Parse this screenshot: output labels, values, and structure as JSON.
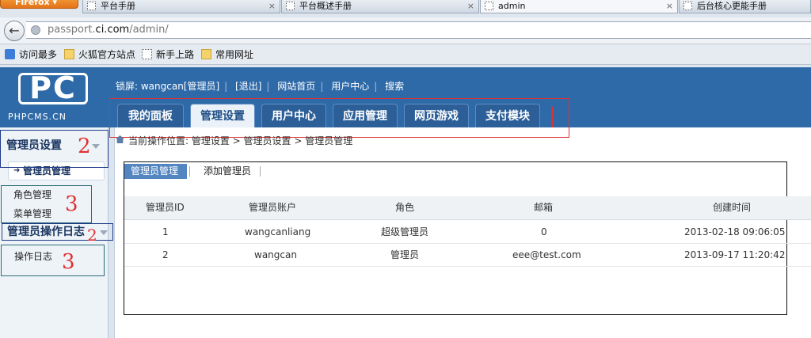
{
  "browser": {
    "app_button": "Firefox",
    "tabs": [
      {
        "title": "平台手册",
        "active": false
      },
      {
        "title": "平台概述手册",
        "active": false
      },
      {
        "title": "admin",
        "active": true
      },
      {
        "title": "后台核心更能手册",
        "active": false
      }
    ],
    "close_glyph": "×",
    "back_glyph": "←",
    "url_prefix": "passport.",
    "url_host": "ci.com",
    "url_path": "/admin/",
    "bookmarks": [
      {
        "label": "访问最多",
        "icon": "most-visited-icon"
      },
      {
        "label": "火狐官方站点",
        "icon": "folder-icon"
      },
      {
        "label": "新手上路",
        "icon": "page-icon"
      },
      {
        "label": "常用网址",
        "icon": "folder-icon"
      }
    ]
  },
  "header": {
    "logo_mark": "PC",
    "logo_text": "PHPCMS.CN",
    "topnav": {
      "user": "锁屏: wangcan[管理员]",
      "logout": "[退出]",
      "site_home": "网站首页",
      "user_center": "用户中心",
      "search": "搜索"
    },
    "main_tabs": [
      {
        "label": "我的面板",
        "active": false
      },
      {
        "label": "管理设置",
        "active": true
      },
      {
        "label": "用户中心",
        "active": false
      },
      {
        "label": "应用管理",
        "active": false
      },
      {
        "label": "网页游戏",
        "active": false
      },
      {
        "label": "支付模块",
        "active": false
      }
    ]
  },
  "annotations": {
    "mark_1": "|",
    "mark_2a": "2",
    "mark_3a": "3",
    "mark_2b": "2",
    "mark_3b": "3"
  },
  "sidebar": {
    "section_admin": "管理员设置",
    "active_item": "管理员管理",
    "arrow_glyph": "➜",
    "items_admin": [
      "角色管理",
      "菜单管理"
    ],
    "section_log": "管理员操作日志",
    "items_log": [
      "操作日志"
    ]
  },
  "breadcrumb": "当前操作位置: 管理设置 > 管理员设置 > 管理员管理",
  "subtabs": [
    "管理员管理",
    "添加管理员"
  ],
  "table": {
    "headers": [
      "管理员ID",
      "管理员账户",
      "角色",
      "邮箱",
      "创建时间"
    ],
    "rows": [
      [
        "1",
        "wangcanliang",
        "超级管理员",
        "0",
        "2013-02-18 09:06:05"
      ],
      [
        "2",
        "wangcan",
        "管理员",
        "eee@test.com",
        "2013-09-17 11:20:42"
      ]
    ]
  },
  "colors": {
    "header_blue": "#2f6aa8",
    "annotation_red": "#e03030",
    "annotation_blue": "#1e3a8a",
    "subtab_active": "#5386c1"
  }
}
